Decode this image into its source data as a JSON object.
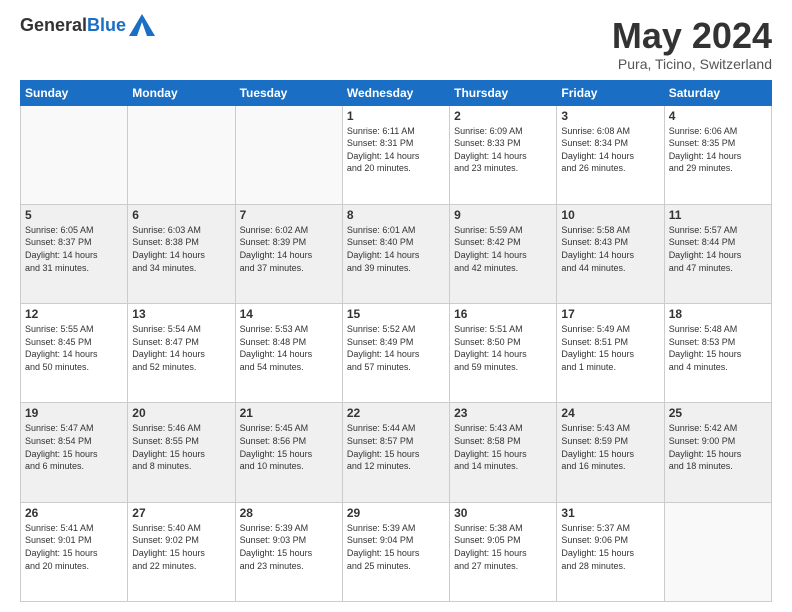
{
  "header": {
    "logo_general": "General",
    "logo_blue": "Blue",
    "month_title": "May 2024",
    "location": "Pura, Ticino, Switzerland"
  },
  "days_of_week": [
    "Sunday",
    "Monday",
    "Tuesday",
    "Wednesday",
    "Thursday",
    "Friday",
    "Saturday"
  ],
  "weeks": [
    [
      {
        "day": "",
        "info": ""
      },
      {
        "day": "",
        "info": ""
      },
      {
        "day": "",
        "info": ""
      },
      {
        "day": "1",
        "info": "Sunrise: 6:11 AM\nSunset: 8:31 PM\nDaylight: 14 hours\nand 20 minutes."
      },
      {
        "day": "2",
        "info": "Sunrise: 6:09 AM\nSunset: 8:33 PM\nDaylight: 14 hours\nand 23 minutes."
      },
      {
        "day": "3",
        "info": "Sunrise: 6:08 AM\nSunset: 8:34 PM\nDaylight: 14 hours\nand 26 minutes."
      },
      {
        "day": "4",
        "info": "Sunrise: 6:06 AM\nSunset: 8:35 PM\nDaylight: 14 hours\nand 29 minutes."
      }
    ],
    [
      {
        "day": "5",
        "info": "Sunrise: 6:05 AM\nSunset: 8:37 PM\nDaylight: 14 hours\nand 31 minutes."
      },
      {
        "day": "6",
        "info": "Sunrise: 6:03 AM\nSunset: 8:38 PM\nDaylight: 14 hours\nand 34 minutes."
      },
      {
        "day": "7",
        "info": "Sunrise: 6:02 AM\nSunset: 8:39 PM\nDaylight: 14 hours\nand 37 minutes."
      },
      {
        "day": "8",
        "info": "Sunrise: 6:01 AM\nSunset: 8:40 PM\nDaylight: 14 hours\nand 39 minutes."
      },
      {
        "day": "9",
        "info": "Sunrise: 5:59 AM\nSunset: 8:42 PM\nDaylight: 14 hours\nand 42 minutes."
      },
      {
        "day": "10",
        "info": "Sunrise: 5:58 AM\nSunset: 8:43 PM\nDaylight: 14 hours\nand 44 minutes."
      },
      {
        "day": "11",
        "info": "Sunrise: 5:57 AM\nSunset: 8:44 PM\nDaylight: 14 hours\nand 47 minutes."
      }
    ],
    [
      {
        "day": "12",
        "info": "Sunrise: 5:55 AM\nSunset: 8:45 PM\nDaylight: 14 hours\nand 50 minutes."
      },
      {
        "day": "13",
        "info": "Sunrise: 5:54 AM\nSunset: 8:47 PM\nDaylight: 14 hours\nand 52 minutes."
      },
      {
        "day": "14",
        "info": "Sunrise: 5:53 AM\nSunset: 8:48 PM\nDaylight: 14 hours\nand 54 minutes."
      },
      {
        "day": "15",
        "info": "Sunrise: 5:52 AM\nSunset: 8:49 PM\nDaylight: 14 hours\nand 57 minutes."
      },
      {
        "day": "16",
        "info": "Sunrise: 5:51 AM\nSunset: 8:50 PM\nDaylight: 14 hours\nand 59 minutes."
      },
      {
        "day": "17",
        "info": "Sunrise: 5:49 AM\nSunset: 8:51 PM\nDaylight: 15 hours\nand 1 minute."
      },
      {
        "day": "18",
        "info": "Sunrise: 5:48 AM\nSunset: 8:53 PM\nDaylight: 15 hours\nand 4 minutes."
      }
    ],
    [
      {
        "day": "19",
        "info": "Sunrise: 5:47 AM\nSunset: 8:54 PM\nDaylight: 15 hours\nand 6 minutes."
      },
      {
        "day": "20",
        "info": "Sunrise: 5:46 AM\nSunset: 8:55 PM\nDaylight: 15 hours\nand 8 minutes."
      },
      {
        "day": "21",
        "info": "Sunrise: 5:45 AM\nSunset: 8:56 PM\nDaylight: 15 hours\nand 10 minutes."
      },
      {
        "day": "22",
        "info": "Sunrise: 5:44 AM\nSunset: 8:57 PM\nDaylight: 15 hours\nand 12 minutes."
      },
      {
        "day": "23",
        "info": "Sunrise: 5:43 AM\nSunset: 8:58 PM\nDaylight: 15 hours\nand 14 minutes."
      },
      {
        "day": "24",
        "info": "Sunrise: 5:43 AM\nSunset: 8:59 PM\nDaylight: 15 hours\nand 16 minutes."
      },
      {
        "day": "25",
        "info": "Sunrise: 5:42 AM\nSunset: 9:00 PM\nDaylight: 15 hours\nand 18 minutes."
      }
    ],
    [
      {
        "day": "26",
        "info": "Sunrise: 5:41 AM\nSunset: 9:01 PM\nDaylight: 15 hours\nand 20 minutes."
      },
      {
        "day": "27",
        "info": "Sunrise: 5:40 AM\nSunset: 9:02 PM\nDaylight: 15 hours\nand 22 minutes."
      },
      {
        "day": "28",
        "info": "Sunrise: 5:39 AM\nSunset: 9:03 PM\nDaylight: 15 hours\nand 23 minutes."
      },
      {
        "day": "29",
        "info": "Sunrise: 5:39 AM\nSunset: 9:04 PM\nDaylight: 15 hours\nand 25 minutes."
      },
      {
        "day": "30",
        "info": "Sunrise: 5:38 AM\nSunset: 9:05 PM\nDaylight: 15 hours\nand 27 minutes."
      },
      {
        "day": "31",
        "info": "Sunrise: 5:37 AM\nSunset: 9:06 PM\nDaylight: 15 hours\nand 28 minutes."
      },
      {
        "day": "",
        "info": ""
      }
    ]
  ]
}
